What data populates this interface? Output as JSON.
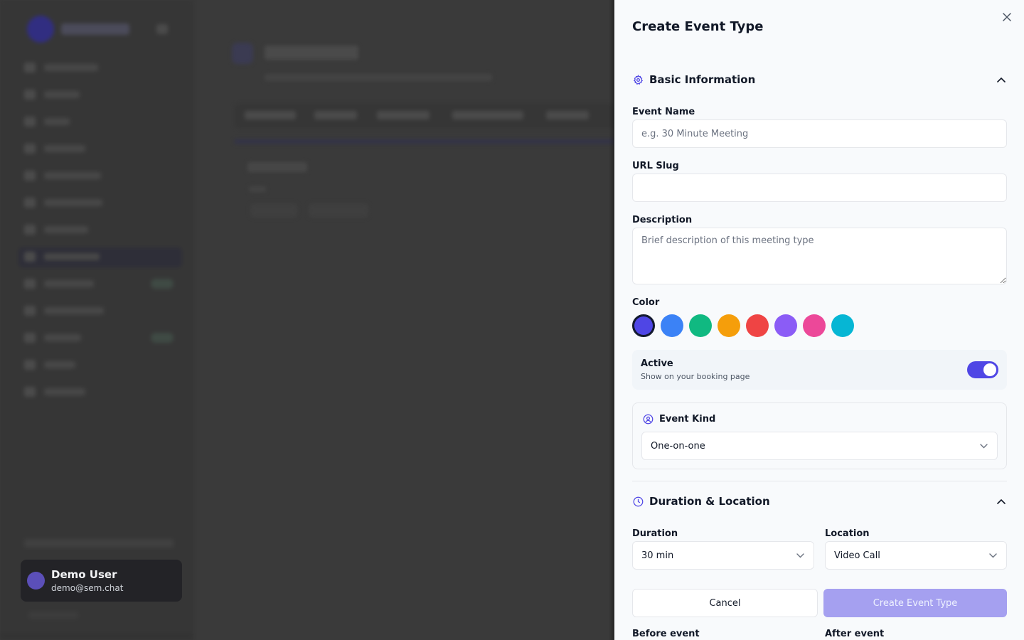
{
  "user": {
    "name": "Demo User",
    "email": "demo@sem.chat"
  },
  "drawer": {
    "title": "Create Event Type",
    "basic_section": {
      "title": "Basic Information"
    },
    "fields": {
      "event_name": {
        "label": "Event Name",
        "value": "",
        "placeholder": "e.g. 30 Minute Meeting"
      },
      "url_slug": {
        "label": "URL Slug",
        "value": "",
        "placeholder": ""
      },
      "description": {
        "label": "Description",
        "value": "",
        "placeholder": "Brief description of this meeting type"
      }
    },
    "color": {
      "label": "Color",
      "selected_index": 0,
      "options": [
        "#4f46e5",
        "#3b82f6",
        "#10b981",
        "#f59e0b",
        "#ef4444",
        "#8b5cf6",
        "#ec4899",
        "#06b6d4"
      ]
    },
    "active": {
      "title": "Active",
      "subtitle": "Show on your booking page",
      "enabled": true
    },
    "event_kind": {
      "label": "Event Kind",
      "value": "One-on-one"
    },
    "duration_section": {
      "title": "Duration & Location"
    },
    "duration": {
      "label": "Duration",
      "value": "30 min"
    },
    "location": {
      "label": "Location",
      "value": "Video Call"
    },
    "buttons": {
      "cancel": "Cancel",
      "create": "Create Event Type"
    },
    "buffers": {
      "before": "Before event",
      "after": "After event"
    }
  },
  "colors": {
    "accent": "#4f46e5",
    "accent_disabled": "#a5a0f0"
  },
  "icons": [
    "close-icon",
    "gear-icon",
    "chevron-up-icon",
    "user-circle-icon",
    "chevron-down-icon",
    "clock-icon"
  ]
}
